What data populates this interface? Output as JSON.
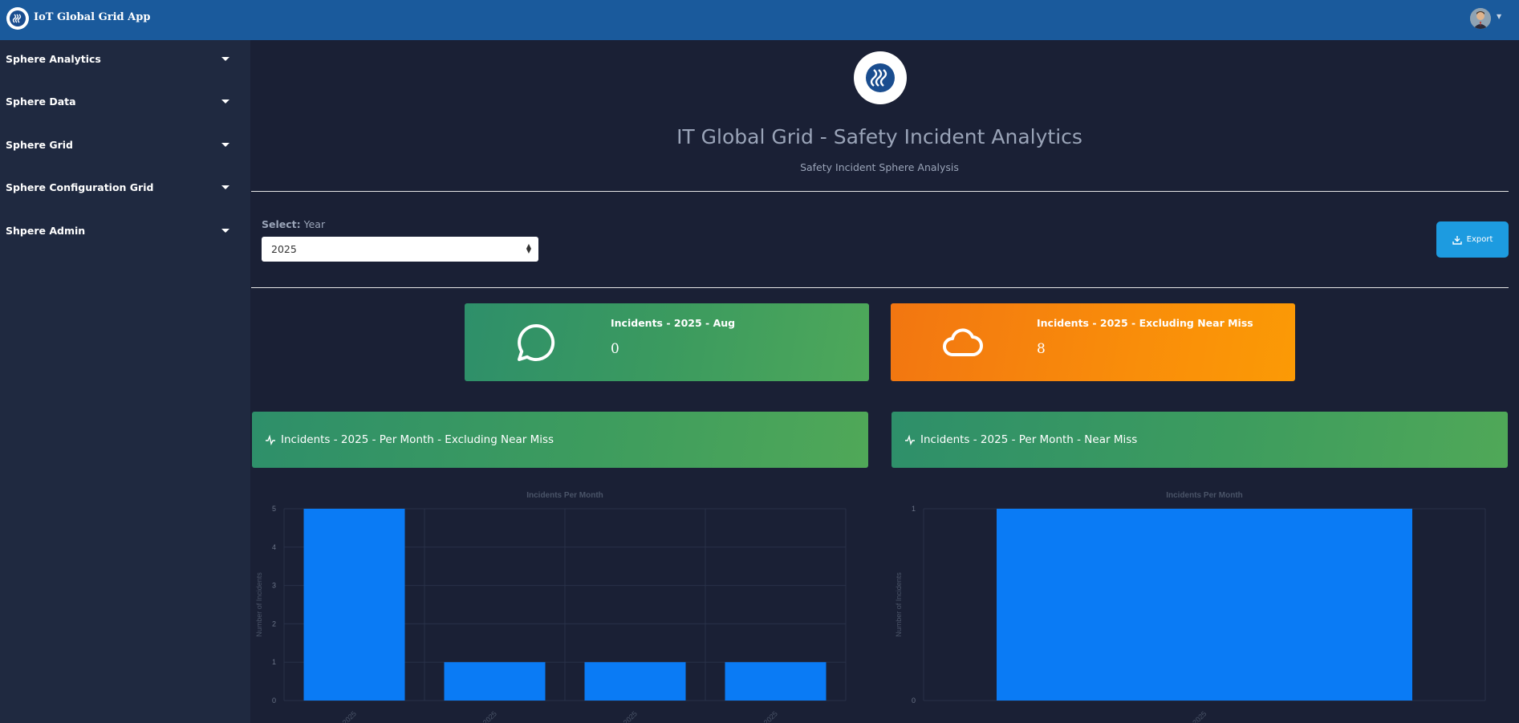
{
  "app": {
    "title": "IoT Global Grid App"
  },
  "sidebar": {
    "items": [
      {
        "label": "Sphere Analytics"
      },
      {
        "label": "Sphere Data"
      },
      {
        "label": "Sphere Grid"
      },
      {
        "label": "Sphere Configuration Grid"
      },
      {
        "label": "Shpere Admin"
      }
    ]
  },
  "header": {
    "title": "IT Global Grid - Safety Incident Analytics",
    "subtitle": "Safety Incident Sphere Analysis"
  },
  "filter": {
    "label_bold": "Select:",
    "label": "Year",
    "selected": "2025"
  },
  "export": {
    "label": "Export"
  },
  "cards": [
    {
      "title_prefix": "Incidents - ",
      "title_bold": "2025 - Aug",
      "title_suffix": "",
      "value": "0",
      "icon": "chat-bubble-icon",
      "color": "#3b9a5f"
    },
    {
      "title_prefix": "Incidents - ",
      "title_bold": "2025",
      "title_suffix": " - Excluding Near Miss",
      "value": "8",
      "icon": "cloud-icon",
      "color": "#f98d0a"
    }
  ],
  "panels": [
    {
      "title": "Incidents - 2025 - Per Month - Excluding Near Miss"
    },
    {
      "title": "Incidents - 2025 - Per Month - Near Miss"
    }
  ],
  "colors": {
    "bar": "#0a7bf5",
    "topbar": "#1a5a9c",
    "sidebar": "#1f2940",
    "background": "#1a2035"
  },
  "chart_data": [
    {
      "type": "bar",
      "title": "Incidents Per Month",
      "ylabel": "Number of Incidents",
      "xlabel": "",
      "categories": [
        "2025",
        "2025",
        "2025",
        "2025"
      ],
      "values": [
        5,
        1,
        1,
        1
      ],
      "ylim": [
        0,
        5
      ],
      "yticks": [
        "0",
        "1",
        "2",
        "3",
        "4",
        "5"
      ],
      "grid": true
    },
    {
      "type": "bar",
      "title": "Incidents Per Month",
      "ylabel": "Number of Incidents",
      "xlabel": "",
      "categories": [
        "2025"
      ],
      "values": [
        1
      ],
      "ylim": [
        0,
        1
      ],
      "yticks": [
        "0",
        "1"
      ],
      "grid": true
    }
  ]
}
